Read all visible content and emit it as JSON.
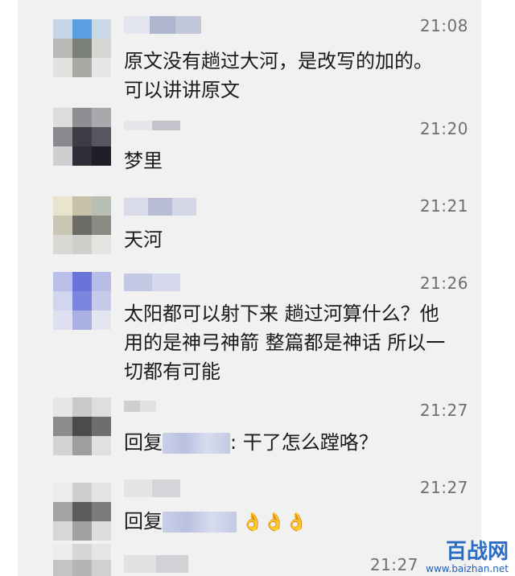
{
  "messages": [
    {
      "time": "21:08",
      "lines": [
        "原文没有趟过大河，是改写的加的。",
        "可以讲讲原文"
      ]
    },
    {
      "time": "21:20",
      "lines": [
        "梦里"
      ]
    },
    {
      "time": "21:21",
      "lines": [
        "天河"
      ]
    },
    {
      "time": "21:26",
      "lines": [
        "太阳都可以射下来 趟过河算什么？他",
        "用的是神弓神箭 整篇都是神话 所以一",
        "切都有可能"
      ]
    },
    {
      "time": "21:27",
      "reply_prefix": "回复",
      "reply_suffix": ": 干了怎么蹚咯？"
    },
    {
      "time": "21:27",
      "reply_prefix": "回复",
      "emoji": "👌👌👌"
    }
  ],
  "partial_time": "21:27",
  "watermark": {
    "main": "百战网",
    "url": "www.baizhan.net"
  },
  "colors": {
    "panel_bg": "#f1f1f1",
    "time": "#6f6f6f",
    "text": "#1b1b1b",
    "watermark": "#2b6cc4"
  }
}
